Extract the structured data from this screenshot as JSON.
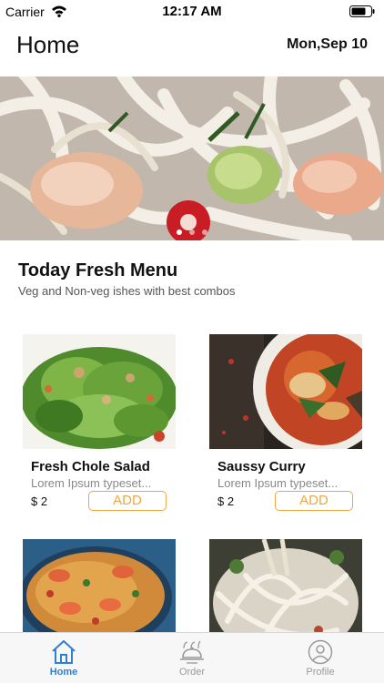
{
  "status_bar": {
    "carrier": "Carrier",
    "time": "12:17 AM",
    "icons": [
      "wifi-icon",
      "battery-icon"
    ]
  },
  "header": {
    "title": "Home",
    "date": "Mon,Sep 10"
  },
  "carousel": {
    "slides": [
      "noodle-shrimp-dish-image"
    ],
    "page_count": 3,
    "active_page": 1
  },
  "menu": {
    "title": "Today Fresh Menu",
    "subtitle": "Veg and Non-veg ishes with best combos",
    "items": [
      {
        "name": "Fresh Chole Salad",
        "description": "Lorem Ipsum typeset...",
        "price": "$ 2",
        "button": "ADD",
        "image": "green-salad-image"
      },
      {
        "name": "Saussy Curry",
        "description": "Lorem Ipsum typeset...",
        "price": "$ 2",
        "button": "ADD",
        "image": "curry-bowl-image"
      },
      {
        "name": "",
        "description": "",
        "price": "",
        "button": "",
        "image": "paella-image"
      },
      {
        "name": "",
        "description": "",
        "price": "",
        "button": "",
        "image": "noodle-bowl-image"
      }
    ]
  },
  "tab_bar": {
    "tabs": [
      {
        "label": "Home",
        "icon": "home-icon",
        "active": true
      },
      {
        "label": "Order",
        "icon": "cloche-icon",
        "active": false
      },
      {
        "label": "Profile",
        "icon": "profile-icon",
        "active": false
      }
    ]
  },
  "colors": {
    "accent": "#f0a642",
    "tab_active": "#2f7fd3",
    "tab_inactive": "#9a9a9a",
    "background": "#ffffff"
  }
}
